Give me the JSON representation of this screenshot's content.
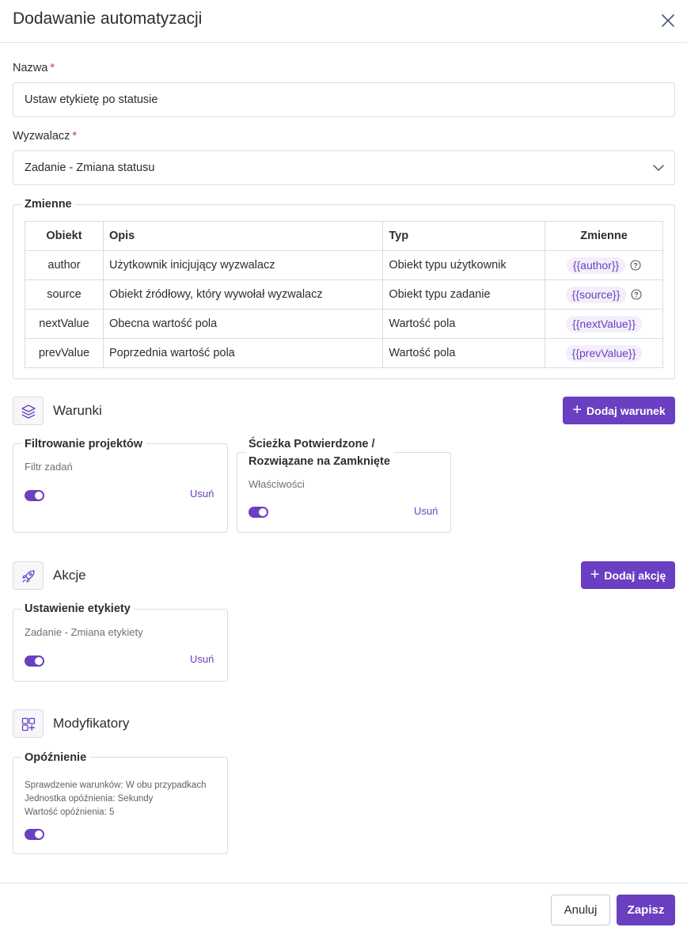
{
  "modal": {
    "title": "Dodawanie automatyzacji"
  },
  "form": {
    "name": {
      "label": "Nazwa",
      "required_mark": "*",
      "value": "Ustaw etykietę po statusie"
    },
    "trigger": {
      "label": "Wyzwalacz",
      "required_mark": "*",
      "value": "Zadanie - Zmiana statusu"
    }
  },
  "variables": {
    "legend": "Zmienne",
    "headers": [
      "Obiekt",
      "Opis",
      "Typ",
      "Zmienne"
    ],
    "rows": [
      {
        "object": "author",
        "description": "Użytkownik inicjujący wyzwalacz",
        "type": "Obiekt typu użytkownik",
        "variable": "{{author}}",
        "has_help": true
      },
      {
        "object": "source",
        "description": "Obiekt źródłowy, który wywołał wyzwalacz",
        "type": "Obiekt typu zadanie",
        "variable": "{{source}}",
        "has_help": true
      },
      {
        "object": "nextValue",
        "description": "Obecna wartość pola",
        "type": "Wartość pola",
        "variable": "{{nextValue}}",
        "has_help": false
      },
      {
        "object": "prevValue",
        "description": "Poprzednia wartość pola",
        "type": "Wartość pola",
        "variable": "{{prevValue}}",
        "has_help": false
      }
    ]
  },
  "conditions": {
    "title": "Warunki",
    "add_label": "Dodaj warunek",
    "cards": [
      {
        "title": "Filtrowanie projektów",
        "subtitle": "Filtr zadań",
        "enabled": true,
        "remove_label": "Usuń"
      },
      {
        "title_line1": "Ścieżka Potwierdzone /",
        "title_line2": "Rozwiązane na Zamknięte",
        "subtitle": "Właściwości",
        "enabled": true,
        "remove_label": "Usuń"
      }
    ]
  },
  "actions": {
    "title": "Akcje",
    "add_label": "Dodaj akcję",
    "cards": [
      {
        "title": "Ustawienie etykiety",
        "subtitle": "Zadanie - Zmiana etykiety",
        "enabled": true,
        "remove_label": "Usuń"
      }
    ]
  },
  "modifiers": {
    "title": "Modyfikatory",
    "cards": [
      {
        "title": "Opóźnienie",
        "lines": [
          "Sprawdzenie warunków: W obu przypadkach",
          "Jednostka opóźnienia: Sekundy",
          "Wartość opóźnienia: 5"
        ],
        "enabled": true
      }
    ]
  },
  "footer": {
    "cancel_label": "Anuluj",
    "save_label": "Zapisz"
  },
  "colors": {
    "accent": "#6a3fc1",
    "chip_bg": "#f3eef9",
    "required": "#d23b3b",
    "border": "#dcdce2"
  },
  "icons": {
    "close": "close-icon",
    "chevron": "chevron-down-icon",
    "help": "help-circle-icon",
    "conditions": "layers-icon",
    "actions": "rocket-icon",
    "modifiers": "puzzle-icon"
  }
}
